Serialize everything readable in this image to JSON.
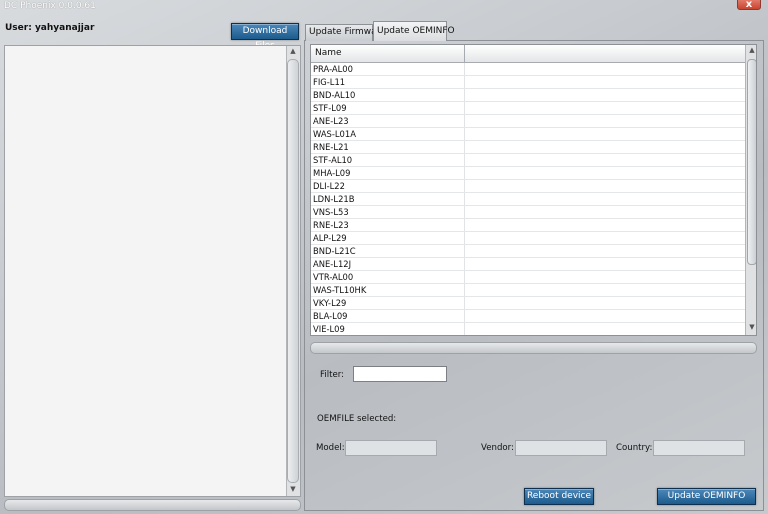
{
  "window": {
    "title": "DC Phoenix 0.0.0.61",
    "close_glyph": "x"
  },
  "user": {
    "label": "User: yahyanajjar"
  },
  "buttons": {
    "download": "Download Files",
    "reboot": "Reboot device",
    "update": "Update OEMINFO"
  },
  "tabs": [
    {
      "label": "Update Firmware",
      "active": false
    },
    {
      "label": "Update OEMINFO",
      "active": true
    }
  ],
  "table": {
    "columns": [
      "Name",
      ""
    ],
    "rows": [
      "PRA-AL00",
      "FIG-L11",
      "BND-AL10",
      "STF-L09",
      "ANE-L23",
      "WAS-L01A",
      "RNE-L21",
      "STF-AL10",
      "MHA-L09",
      "DLI-L22",
      "LDN-L21B",
      "VNS-L53",
      "RNE-L23",
      "ALP-L29",
      "BND-L21C",
      "ANE-L12J",
      "VTR-AL00",
      "WAS-TL10HK",
      "VKY-L29",
      "BLA-L09",
      "VIE-L09"
    ]
  },
  "form": {
    "filter_label": "Filter:",
    "filter_value": "",
    "oemfile_label": "OEMFILE selected:",
    "model_label": "Model:",
    "vendor_label": "Vendor:",
    "country_label": "Country:"
  },
  "icons": {
    "scroll_up": "▲",
    "scroll_down": "▼"
  },
  "colors": {
    "button_blue": "#2b6b9f",
    "close_red": "#d0513d"
  }
}
